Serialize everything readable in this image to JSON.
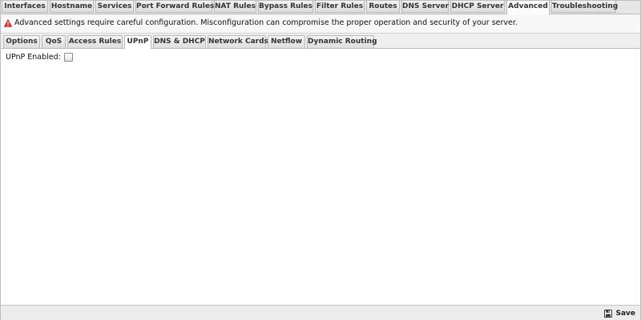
{
  "top_tabs": [
    {
      "label": "Interfaces"
    },
    {
      "label": "Hostname"
    },
    {
      "label": "Services"
    },
    {
      "label": "Port Forward Rules"
    },
    {
      "label": "NAT Rules"
    },
    {
      "label": "Bypass Rules"
    },
    {
      "label": "Filter Rules"
    },
    {
      "label": "Routes"
    },
    {
      "label": "DNS Server"
    },
    {
      "label": "DHCP Server"
    },
    {
      "label": "Advanced"
    },
    {
      "label": "Troubleshooting"
    }
  ],
  "active_top_tab": "Advanced",
  "warning": {
    "icon": "warning-triangle-icon",
    "text": "Advanced settings require careful configuration. Misconfiguration can compromise the proper operation and security of your server."
  },
  "sub_tabs": [
    {
      "label": "Options"
    },
    {
      "label": "QoS"
    },
    {
      "label": "Access Rules"
    },
    {
      "label": "UPnP"
    },
    {
      "label": "DNS & DHCP"
    },
    {
      "label": "Network Cards"
    },
    {
      "label": "Netflow"
    },
    {
      "label": "Dynamic Routing"
    }
  ],
  "active_sub_tab": "UPnP",
  "upnp": {
    "label": "UPnP Enabled:",
    "checked": false
  },
  "footer": {
    "save_label": "Save",
    "save_icon": "floppy-disk-icon"
  },
  "colors": {
    "warning_red": "#d9302c",
    "tab_border": "#b9b9b9",
    "content_bg": "#ffffff"
  }
}
